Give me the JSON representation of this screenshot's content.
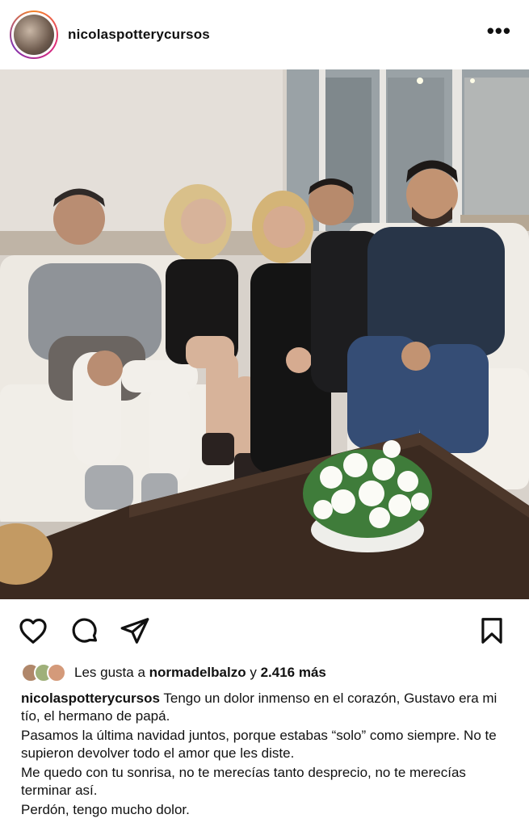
{
  "post": {
    "username": "nicolaspotterycursos",
    "more_label": "•••"
  },
  "icons": {
    "like": "heart-icon",
    "comment": "comment-icon",
    "share": "paper-plane-icon",
    "save": "bookmark-icon",
    "more": "more-options-icon"
  },
  "likes": {
    "prefix": "Les gusta a",
    "liker": "normadelbalzo",
    "connector": "y",
    "count": "2.416 más"
  },
  "caption": {
    "username": "nicolaspotterycursos",
    "lines": [
      "Tengo un dolor inmenso en el corazón, Gustavo era mi tío, el hermano de papá.",
      "Pasamos la última navidad juntos, porque estabas “solo” como siempre. No te supieron devolver todo el amor que les diste.",
      "Me quedo con tu sonrisa, no te merecías tanto desprecio, no te merecías terminar así.",
      "Perdón, tengo mucho dolor."
    ]
  },
  "colors": {
    "text": "#111111",
    "background": "#ffffff",
    "story_ring_start": "#f58529",
    "story_ring_end": "#8134af"
  }
}
